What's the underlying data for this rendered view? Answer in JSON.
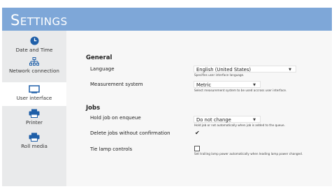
{
  "header": {
    "title": "Settings"
  },
  "sidebar": {
    "items": [
      {
        "label": "Date and Time",
        "icon": "clock-icon"
      },
      {
        "label": "Network connection",
        "icon": "network-icon"
      },
      {
        "label": "User interface",
        "icon": "monitor-icon"
      },
      {
        "label": "Printer",
        "icon": "printer-icon"
      },
      {
        "label": "Roll media",
        "icon": "roll-printer-icon"
      }
    ],
    "active_item": "User interface"
  },
  "general": {
    "title": "General",
    "language": {
      "label": "Language",
      "value": "English (United States)",
      "hint": "Specifies user interface language."
    },
    "measurement": {
      "label": "Measurement system",
      "value": "Metric",
      "hint": "Select measurement system to be used accross user interface."
    }
  },
  "jobs": {
    "title": "Jobs",
    "hold": {
      "label": "Hold job on enqueue",
      "value": "Do not change",
      "hint": "Hold job or not automatically when job is added to the queue."
    },
    "delete": {
      "label": "Delete jobs without confirmation",
      "checked": true,
      "mark": "✔"
    },
    "tie": {
      "label": "Tie lamp controls",
      "checked": false,
      "hint": "Set trailing lamp power automatically when leading lamp power changed."
    }
  },
  "colors": {
    "header": "#7ea7d8",
    "icon": "#1f5fa8",
    "sidebar": "#e9eaeb",
    "content": "#f7f7f7"
  }
}
